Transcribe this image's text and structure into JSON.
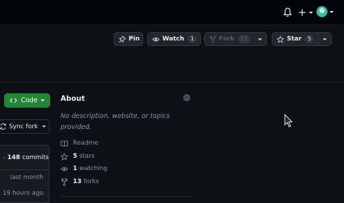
{
  "header": {
    "icons": [
      "bell-icon",
      "plus-icon",
      "avatar"
    ]
  },
  "actions": {
    "pin": {
      "label": "Pin"
    },
    "watch": {
      "label": "Watch",
      "count": "1"
    },
    "fork": {
      "label": "Fork",
      "count": "13"
    },
    "star": {
      "label": "Star",
      "count": "5"
    }
  },
  "code": {
    "label": "Code"
  },
  "sync_fork": {
    "label": "Sync fork"
  },
  "commits": {
    "count": "148",
    "label": "commits",
    "rows": [
      "last month",
      "19 hours ago"
    ]
  },
  "about": {
    "title": "About",
    "description": "No description, website, or topics provided.",
    "readme": "Readme",
    "stars_count": "5",
    "stars_label": "stars",
    "watching_count": "1",
    "watching_label": "watching",
    "forks_count": "13",
    "forks_label": "forks"
  },
  "colors": {
    "background": "#0d1117",
    "code_button": "#238636",
    "muted_text": "#8b949e"
  }
}
